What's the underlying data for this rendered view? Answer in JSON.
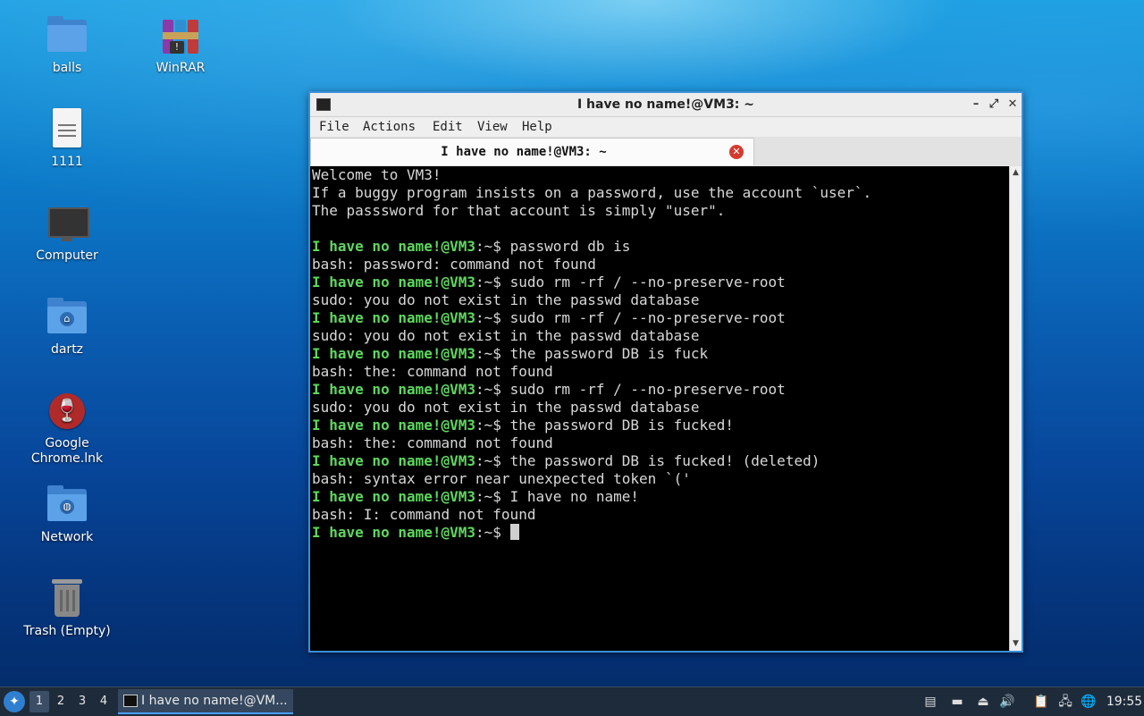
{
  "desktop": {
    "icons": [
      {
        "label": "balls",
        "icon": "folder-icon"
      },
      {
        "label": "WinRAR",
        "icon": "winrar-icon"
      },
      {
        "label": "1111",
        "icon": "text-file-icon"
      },
      {
        "label": "Computer",
        "icon": "computer-icon"
      },
      {
        "label": "dartz",
        "icon": "home-folder-icon"
      },
      {
        "label": "Google Chrome.lnk",
        "icon": "wine-icon"
      },
      {
        "label": "Network",
        "icon": "network-folder-icon"
      },
      {
        "label": "Trash (Empty)",
        "icon": "trash-icon"
      }
    ]
  },
  "terminal": {
    "title": "I have no name!@VM3: ~",
    "menu": [
      "File",
      "Actions",
      "Edit",
      "View",
      "Help"
    ],
    "tab_label": "I have no name!@VM3: ~",
    "prompt": "I have no name!@VM3",
    "lines": [
      {
        "type": "output",
        "text": "Welcome to VM3!"
      },
      {
        "type": "output",
        "text": "If a buggy program insists on a password, use the account `user`."
      },
      {
        "type": "output",
        "text": "The passsword for that account is simply \"user\"."
      },
      {
        "type": "output",
        "text": ""
      },
      {
        "type": "command",
        "text": "password db is"
      },
      {
        "type": "output",
        "text": "bash: password: command not found"
      },
      {
        "type": "command",
        "text": "sudo rm -rf / --no-preserve-root"
      },
      {
        "type": "output",
        "text": "sudo: you do not exist in the passwd database"
      },
      {
        "type": "command",
        "text": "sudo rm -rf / --no-preserve-root"
      },
      {
        "type": "output",
        "text": "sudo: you do not exist in the passwd database"
      },
      {
        "type": "command",
        "text": "the password DB is fuck"
      },
      {
        "type": "output",
        "text": "bash: the: command not found"
      },
      {
        "type": "command",
        "text": "sudo rm -rf / --no-preserve-root"
      },
      {
        "type": "output",
        "text": "sudo: you do not exist in the passwd database"
      },
      {
        "type": "command",
        "text": "the password DB is fucked!"
      },
      {
        "type": "output",
        "text": "bash: the: command not found"
      },
      {
        "type": "command",
        "text": "the password DB is fucked! (deleted)"
      },
      {
        "type": "output",
        "text": "bash: syntax error near unexpected token `('"
      },
      {
        "type": "command",
        "text": "I have no name!"
      },
      {
        "type": "output",
        "text": "bash: I: command not found"
      },
      {
        "type": "prompt",
        "text": ""
      }
    ]
  },
  "taskbar": {
    "workspaces": [
      "1",
      "2",
      "3",
      "4"
    ],
    "active_workspace": "1",
    "task_label": "I have no name!@VM...",
    "tray": [
      "notes-icon",
      "desktop-icon",
      "eject-icon",
      "volume-icon",
      "clipboard-icon",
      "network-icon",
      "update-icon"
    ],
    "clock": "19:55"
  }
}
